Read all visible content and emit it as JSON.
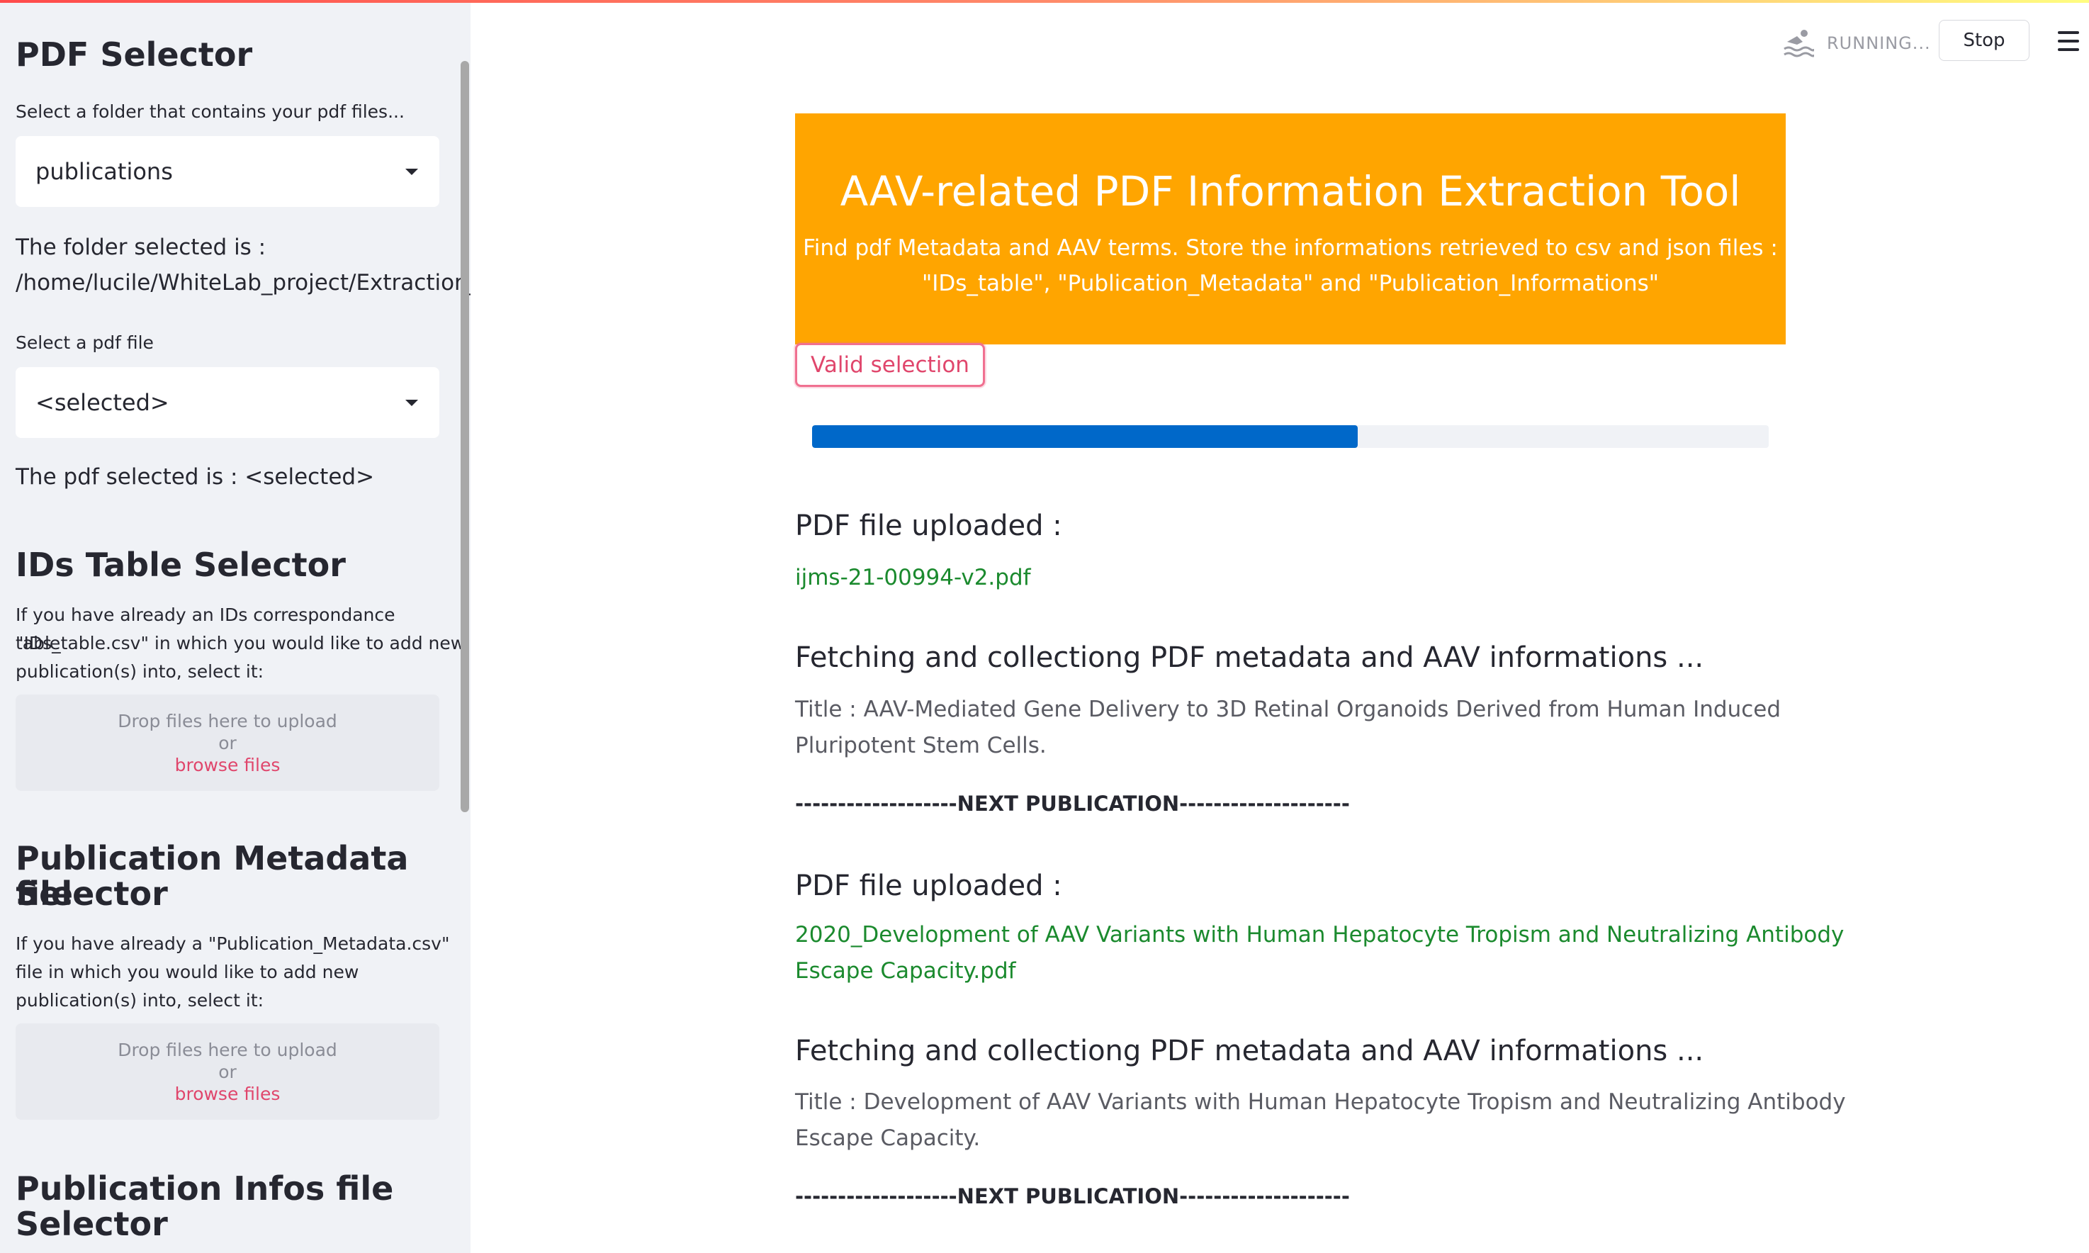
{
  "sidebar": {
    "pdf_selector": {
      "title": "PDF Selector",
      "folder_prompt": "Select a folder that contains your pdf files...",
      "folder_value": "publications",
      "folder_selected_label": "The folder selected is :",
      "folder_selected_path": "/home/lucile/WhiteLab_project/Extraction_",
      "pdf_prompt": "Select a pdf file",
      "pdf_value": "<selected>",
      "pdf_selected_text": "The pdf selected is : <selected>"
    },
    "ids_table": {
      "title": "IDs Table Selector",
      "description_line1": "If you have already an IDs correspondance table",
      "description_line2": "\"IDs_table.csv\" in which you would like to add new",
      "description_line3": "publication(s) into, select it:",
      "drop_text": "Drop files here to upload",
      "or_text": "or",
      "browse_text": "browse files"
    },
    "metadata": {
      "title_line1": "Publication Metadata file",
      "title_line2": "Selector",
      "description_line1": "If you have already a \"Publication_Metadata.csv\"",
      "description_line2": "file in which you would like to add new",
      "description_line3": "publication(s) into, select it:",
      "drop_text": "Drop files here to upload",
      "or_text": "or",
      "browse_text": "browse files"
    },
    "infos": {
      "title_line1": "Publication Infos file",
      "title_line2": "Selector"
    }
  },
  "header": {
    "status_text": "RUNNING...",
    "stop_label": "Stop"
  },
  "banner": {
    "title": "AAV-related PDF Information Extraction Tool",
    "subtitle_line1": "Find pdf Metadata and AAV terms. Store the informations retrieved to csv and json files :",
    "subtitle_line2": "\"IDs_table\", \"Publication_Metadata\" and \"Publication_Informations\""
  },
  "valid_button": "Valid selection",
  "progress": {
    "fraction": 0.57
  },
  "publications": [
    {
      "uploaded_label": "PDF file uploaded :",
      "file_name_line1": "ijms-21-00994-v2.pdf",
      "fetching_label": "Fetching and collectiong PDF metadata and AAV informations ...",
      "title_line1": "Title : AAV-Mediated Gene Delivery to 3D Retinal Organoids Derived from Human Induced",
      "title_line2": "Pluripotent Stem Cells.",
      "separator": "-------------------NEXT PUBLICATION--------------------"
    },
    {
      "uploaded_label": "PDF file uploaded :",
      "file_name_line1": "2020_Development of AAV Variants with Human Hepatocyte Tropism and Neutralizing Antibody",
      "file_name_line2": "Escape Capacity.pdf",
      "fetching_label": "Fetching and collectiong PDF metadata and AAV informations ...",
      "title_line1": "Title : Development of AAV Variants with Human Hepatocyte Tropism and Neutralizing Antibody",
      "title_line2": "Escape Capacity.",
      "separator": "-------------------NEXT PUBLICATION--------------------"
    }
  ],
  "colors": {
    "banner": "#ffa500",
    "progress": "#0068c9",
    "accent": "#e0466c",
    "file_link": "#1b8a2e"
  }
}
